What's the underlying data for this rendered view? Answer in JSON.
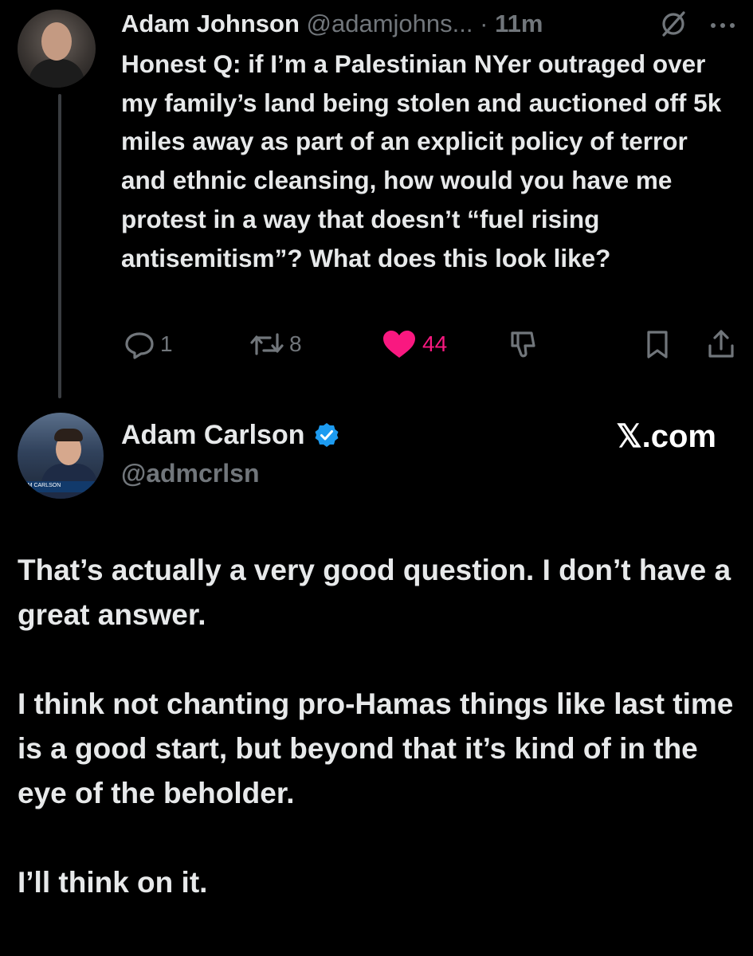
{
  "tweet1": {
    "author_name": "Adam Johnson",
    "handle": "@adamjohns...",
    "separator": "·",
    "time": "11m",
    "text": "Honest Q: if I’m a Palestinian NYer outraged over my family’s land being stolen and auctioned off 5k miles away as part of an explicit policy of terror and ethnic cleansing, how would you have me protest in a way that doesn’t “fuel rising antisemitism”? What does this look like?",
    "actions": {
      "reply_count": "1",
      "repost_count": "8",
      "like_count": "44"
    },
    "icons": [
      "grok-slash-icon",
      "more-icon",
      "reply-icon",
      "repost-icon",
      "heart-icon",
      "dislike-icon",
      "bookmark-icon",
      "share-icon"
    ]
  },
  "tweet2": {
    "author_name": "Adam Carlson",
    "handle": "@admcrlsn",
    "verified": true,
    "avatar_caption": "AM CARLSON",
    "source_label": "𝕏.com",
    "paragraphs": [
      "That’s actually a very good question. I don’t have a great answer.",
      "I think not chanting pro-Hamas things like last time is a good start, but beyond that it’s kind of in the eye of the beholder.",
      "I’ll think on it."
    ]
  },
  "colors": {
    "background": "#000000",
    "text": "#e7e9ea",
    "secondary": "#71767b",
    "like": "#f91880",
    "verified": "#1d9bf0"
  }
}
